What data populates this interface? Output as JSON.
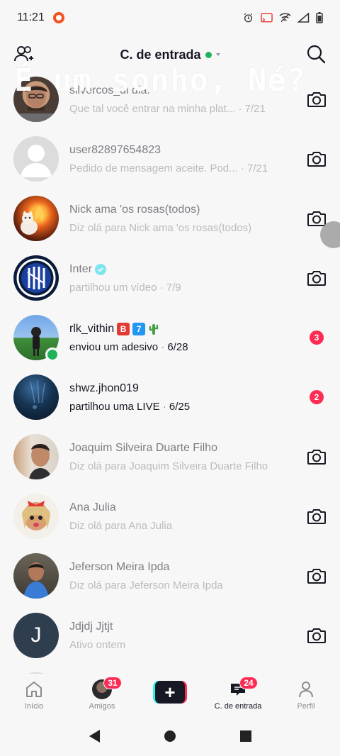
{
  "status_bar": {
    "time": "11:21"
  },
  "overlay_text": "É um sonho, Né?",
  "header": {
    "title": "C. de entrada"
  },
  "conversations": [
    {
      "name": "silvercos_di dia.",
      "preview": "Que tal você entrar na minha plat...",
      "time": "7/21",
      "faded": true,
      "action": "camera"
    },
    {
      "name": "user82897654823",
      "preview": "Pedido de mensagem aceite. Pod...",
      "time": "7/21",
      "faded": true,
      "action": "camera"
    },
    {
      "name": "Nick ama 'os rosas(todos)",
      "preview": "Diz olá para Nick ama 'os rosas(todos)",
      "time": "",
      "faded": true,
      "action": "camera"
    },
    {
      "name": "Inter",
      "preview": "partilhou um vídeo",
      "time": "7/9",
      "faded": true,
      "action": "camera"
    },
    {
      "name": "rlk_vithin",
      "preview": "enviou um adesivo",
      "time": "6/28",
      "faded": false,
      "action": "badge",
      "unread": "3"
    },
    {
      "name": "shwz.jhon019",
      "preview": "partilhou uma LIVE",
      "time": "6/25",
      "faded": false,
      "action": "badge",
      "unread": "2"
    },
    {
      "name": "Joaquim Silveira Duarte Filho",
      "preview": "Diz olá para Joaquim Silveira Duarte Filho",
      "time": "",
      "faded": true,
      "action": "camera"
    },
    {
      "name": "Ana Julia",
      "preview": "Diz olá para Ana Julia",
      "time": "",
      "faded": true,
      "action": "camera"
    },
    {
      "name": "Jeferson Meira Ipda",
      "preview": "Diz olá para Jeferson Meira Ipda",
      "time": "",
      "faded": true,
      "action": "camera"
    },
    {
      "name": "Jdjdj Jjtjt",
      "preview": "Ativo ontem",
      "time": "",
      "faded": true,
      "action": "camera",
      "initial": "J"
    }
  ],
  "rlk_badges": {
    "b": "B",
    "seven": "7"
  },
  "bottom_nav": {
    "home": "Início",
    "friends": "Amigos",
    "friends_badge": "31",
    "inbox": "C. de entrada",
    "inbox_badge": "24",
    "profile": "Perfil"
  },
  "colors": {
    "accent": "#fe2c55",
    "online": "#20b25a",
    "verified": "#20d5ec",
    "text_secondary": "#8a8b91"
  }
}
